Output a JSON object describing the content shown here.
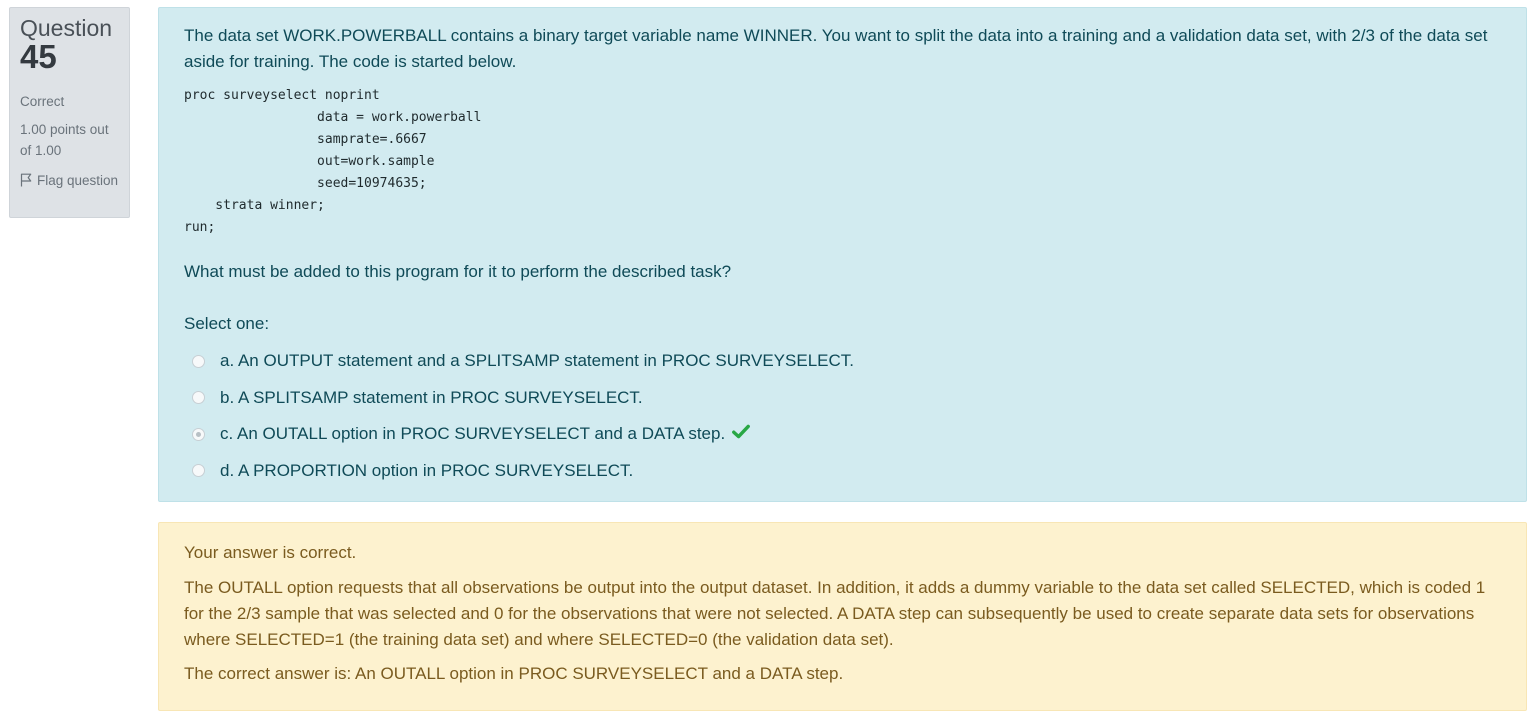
{
  "info": {
    "question_word": "Question",
    "question_number": "45",
    "state": "Correct",
    "grade": "1.00 points out of 1.00",
    "flag_label": "Flag question",
    "flag_icon": "flag-outline-icon"
  },
  "question": {
    "text": "The data set WORK.POWERBALL contains a binary target variable name WINNER. You want to split the data into a training and a validation data set, with 2/3 of the data set aside for training. The code is started below.",
    "code": "proc surveyselect noprint\n                 data = work.powerball\n                 samprate=.6667\n                 out=work.sample\n                 seed=10974635;\n    strata winner;\nrun;",
    "prompt": "What must be added to this program for it to perform the described task?",
    "select_label": "Select one:",
    "options": [
      {
        "label": "a. An OUTPUT statement and a SPLITSAMP statement in PROC SURVEYSELECT.",
        "selected": false
      },
      {
        "label": "b. A SPLITSAMP statement in PROC SURVEYSELECT.",
        "selected": false
      },
      {
        "label": "c. An OUTALL option in PROC SURVEYSELECT and a DATA step.",
        "selected": true,
        "correct_icon": "checkmark-icon"
      },
      {
        "label": "d. A PROPORTION option in PROC SURVEYSELECT.",
        "selected": false
      }
    ]
  },
  "feedback": {
    "status": "Your answer is correct.",
    "explanation": "The OUTALL option requests that all observations be output into the output dataset. In addition, it adds a dummy variable to the data set called SELECTED, which is coded 1 for the 2/3 sample that was selected and 0 for the observations that were not selected. A DATA step can subsequently be used to create separate data sets for observations where SELECTED=1 (the training data set) and where SELECTED=0 (the validation data set).",
    "right_answer": "The correct answer is: An OUTALL option in PROC SURVEYSELECT and a DATA step."
  },
  "colors": {
    "question_bg": "#d2ebf0",
    "feedback_bg": "#fdf2cf",
    "info_bg": "#dee2e6",
    "check_green": "#28a745"
  }
}
